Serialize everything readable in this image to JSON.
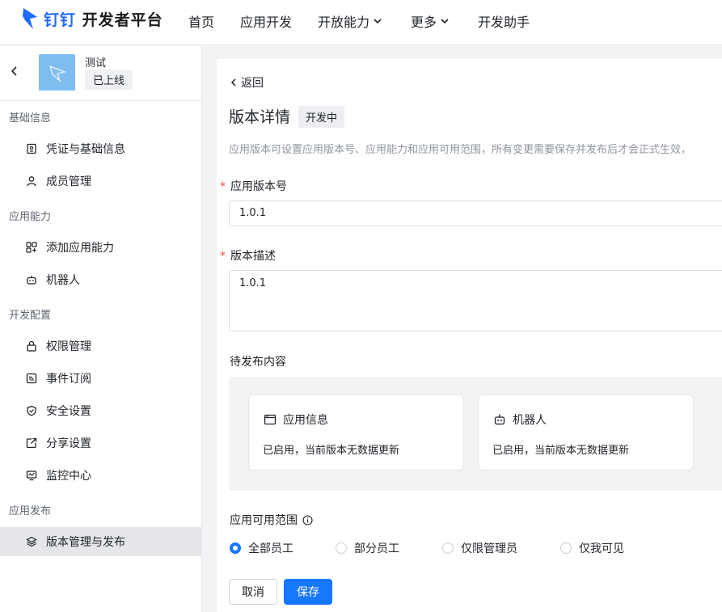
{
  "header": {
    "logo_blue": "钉钉",
    "logo_dark": "开发者平台",
    "nav": [
      {
        "label": "首页",
        "dropdown": false
      },
      {
        "label": "应用开发",
        "dropdown": false
      },
      {
        "label": "开放能力",
        "dropdown": true
      },
      {
        "label": "更多",
        "dropdown": true
      },
      {
        "label": "开发助手",
        "dropdown": false
      }
    ]
  },
  "sidebar": {
    "app_name": "测试",
    "app_status": "已上线",
    "groups": [
      {
        "title": "基础信息",
        "items": [
          {
            "label": "凭证与基础信息",
            "icon": "credential-icon"
          },
          {
            "label": "成员管理",
            "icon": "user-icon"
          }
        ]
      },
      {
        "title": "应用能力",
        "items": [
          {
            "label": "添加应用能力",
            "icon": "add-capability-icon"
          },
          {
            "label": "机器人",
            "icon": "robot-icon"
          }
        ]
      },
      {
        "title": "开发配置",
        "items": [
          {
            "label": "权限管理",
            "icon": "lock-icon"
          },
          {
            "label": "事件订阅",
            "icon": "rss-icon"
          },
          {
            "label": "安全设置",
            "icon": "shield-icon"
          },
          {
            "label": "分享设置",
            "icon": "share-icon"
          },
          {
            "label": "监控中心",
            "icon": "monitor-icon"
          }
        ]
      },
      {
        "title": "应用发布",
        "items": [
          {
            "label": "版本管理与发布",
            "icon": "layers-icon",
            "active": true
          }
        ]
      }
    ]
  },
  "main": {
    "back_label": "返回",
    "title": "版本详情",
    "title_badge": "开发中",
    "description": "应用版本可设置应用版本号、应用能力和应用可用范围，所有变更需要保存并发布后才会正式生效，",
    "version_label": "应用版本号",
    "version_value": "1.0.1",
    "desc_label": "版本描述",
    "desc_value": "1.0.1",
    "pending_label": "待发布内容",
    "cards": [
      {
        "title": "应用信息",
        "text": "已启用，当前版本无数据更新",
        "icon": "window-icon"
      },
      {
        "title": "机器人",
        "text": "已启用，当前版本无数据更新",
        "icon": "robot-icon"
      }
    ],
    "scope_label": "应用可用范围",
    "scope_options": [
      {
        "label": "全部员工",
        "selected": true
      },
      {
        "label": "部分员工",
        "selected": false
      },
      {
        "label": "仅限管理员",
        "selected": false
      },
      {
        "label": "仅我可见",
        "selected": false
      }
    ],
    "cancel_label": "取消",
    "save_label": "保存"
  },
  "colors": {
    "accent": "#1677ff",
    "required": "#f54a45"
  }
}
